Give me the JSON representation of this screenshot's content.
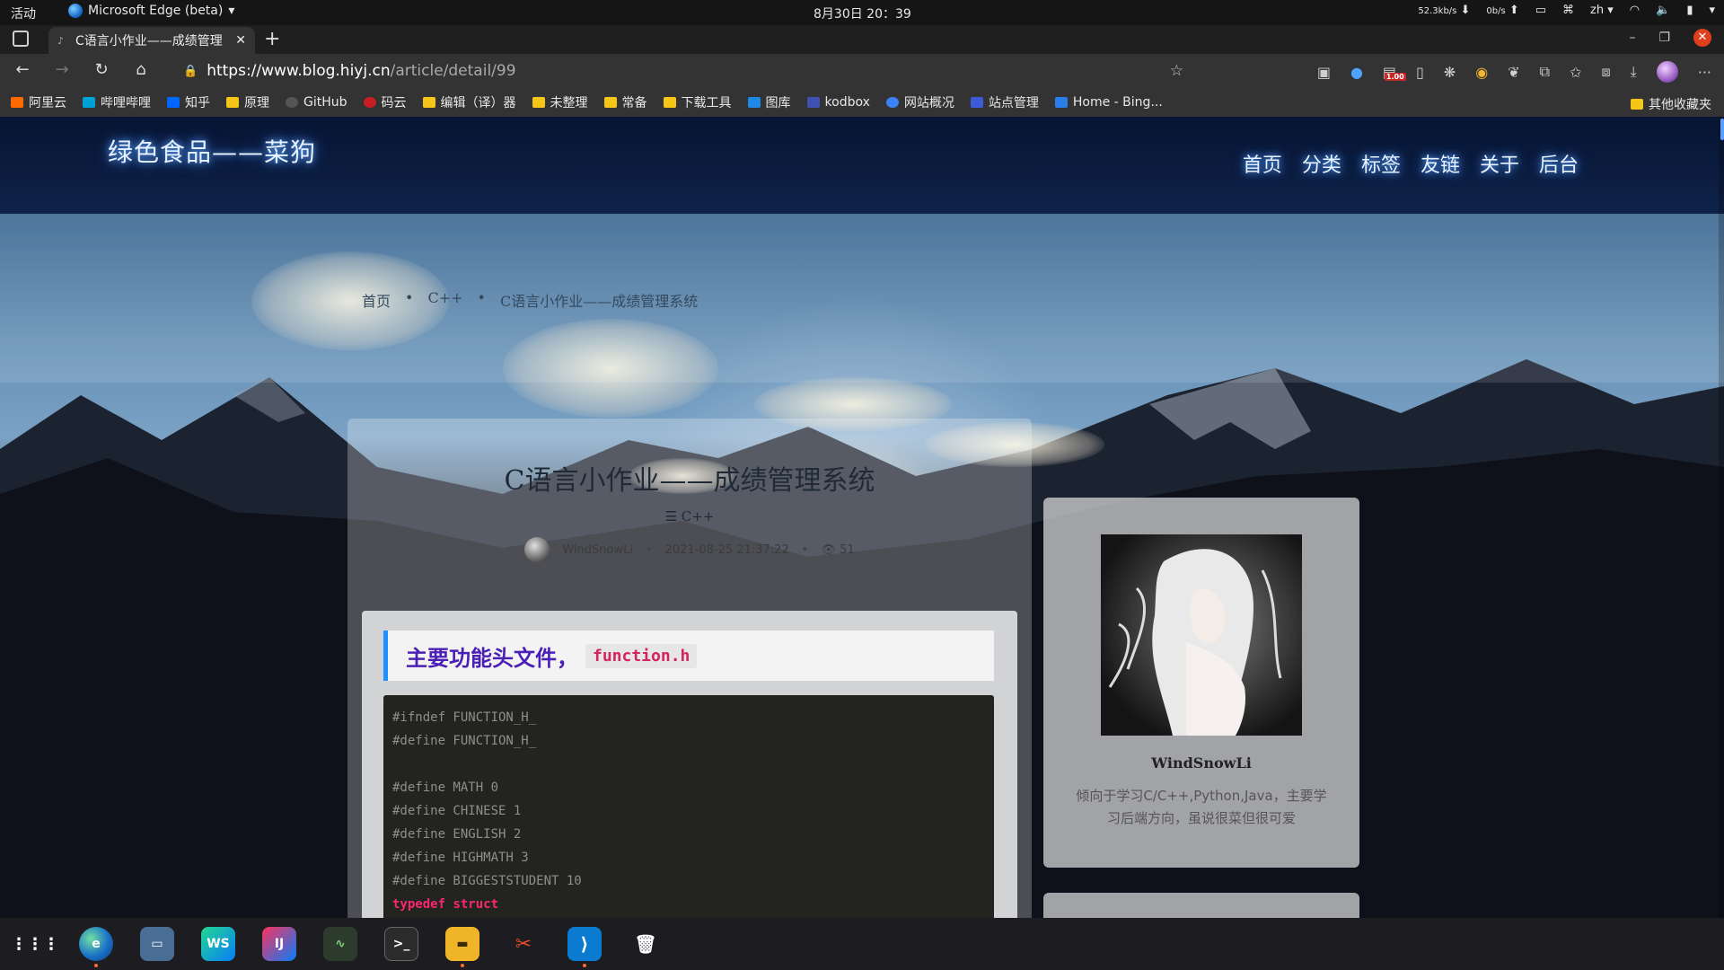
{
  "system": {
    "activities": "活动",
    "app_name": "Microsoft Edge (beta)",
    "clock": "8月30日  20：39",
    "net_down": "52.3kb/s",
    "net_up": "0b/s",
    "lang": "zh"
  },
  "browser": {
    "tab_title": "C语言小作业——成绩管理",
    "url_host": "https://www.blog.hiyj.cn",
    "url_path": "/article/detail/99",
    "ext_badge": "1.00",
    "bookmarks": [
      {
        "label": "阿里云",
        "icon": "aliyun-icon",
        "color": "#ff6a00"
      },
      {
        "label": "哔哩哔哩",
        "icon": "bilibili-icon",
        "color": "#00a1d6"
      },
      {
        "label": "知乎",
        "icon": "zhihu-icon",
        "color": "#0066ff"
      },
      {
        "label": "原理",
        "icon": "folder-icon",
        "color": "#f5c518"
      },
      {
        "label": "GitHub",
        "icon": "github-icon",
        "color": "#333333"
      },
      {
        "label": "码云",
        "icon": "gitee-icon",
        "color": "#c71d23"
      },
      {
        "label": "编辑（译）器",
        "icon": "folder-icon",
        "color": "#f5c518"
      },
      {
        "label": "未整理",
        "icon": "folder-icon",
        "color": "#f5c518"
      },
      {
        "label": "常备",
        "icon": "folder-icon",
        "color": "#f5c518"
      },
      {
        "label": "下载工具",
        "icon": "folder-icon",
        "color": "#f5c518"
      },
      {
        "label": "图库",
        "icon": "gallery-icon",
        "color": "#1e88e5"
      },
      {
        "label": "kodbox",
        "icon": "kodbox-icon",
        "color": "#3f51b5"
      },
      {
        "label": "网站概况",
        "icon": "site-overview-icon",
        "color": "#3b82f6"
      },
      {
        "label": "站点管理",
        "icon": "site-manage-icon",
        "color": "#3b5bdb"
      },
      {
        "label": "Home - Bing...",
        "icon": "bing-icon",
        "color": "#2b7de9"
      }
    ],
    "other_bookmarks": "其他收藏夹"
  },
  "site": {
    "logo": "绿色食品——菜狗",
    "menu": [
      "首页",
      "分类",
      "标签",
      "友链",
      "关于",
      "后台"
    ],
    "breadcrumb": {
      "home": "首页",
      "cat": "C++",
      "current": "C语言小作业——成绩管理系统"
    }
  },
  "article": {
    "title": "C语言小作业——成绩管理系统",
    "category": "C++",
    "author": "WindSnowLi",
    "date": "2021-08-25 21:37:22",
    "views": "51",
    "h2": "主要功能头文件，",
    "h2_code": "function.h",
    "code_lines": [
      "#ifndef FUNCTION_H_",
      "#define FUNCTION_H_",
      "",
      "#define MATH 0",
      "#define CHINESE 1",
      "#define ENGLISH 2",
      "#define HIGHMATH 3",
      "#define BIGGESTSTUDENT 10"
    ],
    "code_kw1": "typedef",
    "code_kw2": "struct"
  },
  "profile": {
    "name": "WindSnowLi",
    "desc": "倾向于学习C/C++,Python,Java，主要学习后端方向，虽说很菜但很可爱"
  },
  "dock": [
    {
      "name": "apps-grid",
      "label": "⋮⋮⋮",
      "color": "#1e1e22"
    },
    {
      "name": "edge-beta",
      "label": "e",
      "color": "#1a73c8"
    },
    {
      "name": "remote-desktop",
      "label": "▭",
      "color": "#3a5f8a"
    },
    {
      "name": "webstorm",
      "label": "WS",
      "color": "#0b8ad9"
    },
    {
      "name": "intellij",
      "label": "IJ",
      "color": "#5b3fd1"
    },
    {
      "name": "system-monitor",
      "label": "∿",
      "color": "#2d3b2d"
    },
    {
      "name": "terminal",
      "label": ">_",
      "color": "#2b2b2b"
    },
    {
      "name": "files",
      "label": "▬",
      "color": "#f0b429"
    },
    {
      "name": "screenshot-tool",
      "label": "✂",
      "color": "#e44d26"
    },
    {
      "name": "vscode",
      "label": "⟩",
      "color": "#0a7bd0"
    },
    {
      "name": "trash",
      "label": "🗑",
      "color": "#3a3a3a"
    }
  ]
}
